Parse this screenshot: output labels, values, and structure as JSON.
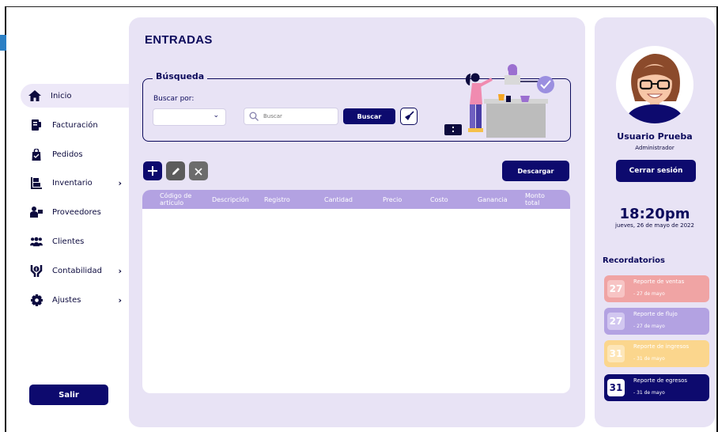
{
  "sidebar": {
    "items": [
      {
        "label": "Inicio",
        "icon": "home-icon",
        "active": true,
        "chevron": ""
      },
      {
        "label": "Facturación",
        "icon": "invoice-icon",
        "active": false,
        "chevron": ""
      },
      {
        "label": "Pedidos",
        "icon": "shopping-bag-icon",
        "active": false,
        "chevron": ""
      },
      {
        "label": "Inventario",
        "icon": "inventory-icon",
        "active": false,
        "chevron": "›"
      },
      {
        "label": "Proveedores",
        "icon": "supplier-icon",
        "active": false,
        "chevron": ""
      },
      {
        "label": "Clientes",
        "icon": "clients-icon",
        "active": false,
        "chevron": ""
      },
      {
        "label": "Contabilidad",
        "icon": "accounting-icon",
        "active": false,
        "chevron": "›"
      },
      {
        "label": "Ajustes",
        "icon": "gear-icon",
        "active": false,
        "chevron": "›"
      }
    ],
    "exit_label": "Salir"
  },
  "main": {
    "title": "ENTRADAS",
    "search": {
      "legend": "Búsqueda",
      "label": "Buscar por:",
      "select_value": "",
      "placeholder": "Buscar",
      "button": "Buscar"
    },
    "toolbar": {
      "add_icon": "plus-icon",
      "edit_icon": "pencil-icon",
      "delete_icon": "close-icon",
      "download_label": "Descargar"
    },
    "table": {
      "columns": [
        "Código de artículo",
        "Descripción",
        "Registro",
        "Cantidad",
        "Precio",
        "Costo",
        "Ganancia",
        "Monto total"
      ],
      "rows": []
    }
  },
  "user": {
    "name": "Usuario Prueba",
    "role": "Administrador",
    "logout_label": "Cerrar sesión"
  },
  "clock": {
    "time": "18:20pm",
    "date": "jueves, 26 de mayo de 2022"
  },
  "reminders": {
    "title": "Recordatorios",
    "items": [
      {
        "day": "27",
        "title": "Reporte de ventas",
        "subtitle": "- 27 de mayo",
        "bg": "#f0a4a4",
        "badge": "#f7c4c4"
      },
      {
        "day": "27",
        "title": "Reporte de flujo",
        "subtitle": "- 27 de mayo",
        "bg": "#b3a2e2",
        "badge": "#d2c7f0"
      },
      {
        "day": "31",
        "title": "Reporte de ingresos",
        "subtitle": "- 31 de mayo",
        "bg": "#fbd68d",
        "badge": "#fde6b8"
      },
      {
        "day": "31",
        "title": "Reporte de egresos",
        "subtitle": "- 31 de mayo",
        "bg": "#0d0a6e",
        "badge": "#ffffff"
      }
    ]
  },
  "colors": {
    "primary": "#0d0a6e",
    "panel": "#e8e3f5",
    "table_header": "#b3a2e2"
  }
}
